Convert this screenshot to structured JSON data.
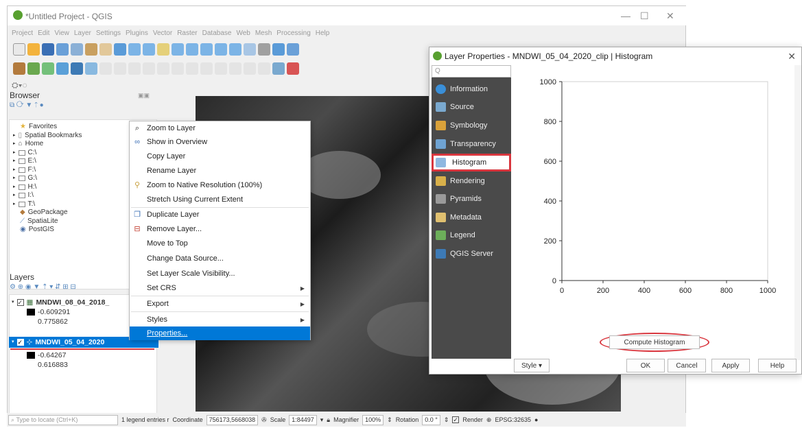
{
  "app": {
    "title": "*Untitled Project - QGIS"
  },
  "menu": [
    "Project",
    "Edit",
    "View",
    "Layer",
    "Settings",
    "Plugins",
    "Vector",
    "Raster",
    "Database",
    "Web",
    "Mesh",
    "Processing",
    "Help"
  ],
  "browser": {
    "title": "Browser",
    "items": [
      "Favorites",
      "Spatial Bookmarks",
      "Home",
      "C:\\",
      "E:\\",
      "F:\\",
      "G:\\",
      "H:\\",
      "I:\\",
      "T:\\",
      "GeoPackage",
      "SpatiaLite",
      "PostGIS"
    ]
  },
  "layers": {
    "title": "Layers",
    "layer1": {
      "name": "MNDWI_08_04_2018_",
      "min": "-0.609291",
      "max": "0.775862"
    },
    "layer2": {
      "name": "MNDWI_05_04_2020",
      "min": "-0.64267",
      "max": "0.616883"
    }
  },
  "context_menu": {
    "zoom_to_layer": "Zoom to Layer",
    "show_overview": "Show in Overview",
    "copy_layer": "Copy Layer",
    "rename_layer": "Rename Layer",
    "zoom_native": "Zoom to Native Resolution (100%)",
    "stretch": "Stretch Using Current Extent",
    "duplicate": "Duplicate Layer",
    "remove": "Remove Layer...",
    "move_top": "Move to Top",
    "change_source": "Change Data Source...",
    "scale_vis": "Set Layer Scale Visibility...",
    "set_crs": "Set CRS",
    "export": "Export",
    "styles": "Styles",
    "properties": "Properties..."
  },
  "dialog": {
    "title": "Layer Properties - MNDWI_05_04_2020_clip | Histogram",
    "search_placeholder": "Q",
    "tabs": [
      "Information",
      "Source",
      "Symbology",
      "Transparency",
      "Histogram",
      "Rendering",
      "Pyramids",
      "Metadata",
      "Legend",
      "QGIS Server"
    ],
    "compute_btn": "Compute Histogram",
    "style_btn": "Style",
    "ok": "OK",
    "cancel": "Cancel",
    "apply": "Apply",
    "help": "Help"
  },
  "chart_data": {
    "type": "line",
    "title": "",
    "xlabel": "",
    "ylabel": "",
    "xlim": [
      0,
      1000
    ],
    "ylim": [
      0,
      1000
    ],
    "xticks": [
      "0",
      "200",
      "400",
      "600",
      "800",
      "1000"
    ],
    "yticks": [
      "0",
      "200",
      "400",
      "600",
      "800",
      "1000"
    ],
    "series": []
  },
  "statusbar": {
    "locate_placeholder": "Type to locate (Ctrl+K)",
    "legend_entries": "1 legend entries r",
    "coordinate_label": "Coordinate",
    "coordinate": "756173,5668038",
    "scale_label": "Scale",
    "scale": "1:84497",
    "magnifier_label": "Magnifier",
    "magnifier": "100%",
    "rotation_label": "Rotation",
    "rotation": "0.0 °",
    "render": "Render",
    "crs": "EPSG:32635"
  },
  "colors": {
    "accent": "#0078d7",
    "highlight": "#d9363e",
    "sidebar": "#4a4a4a"
  }
}
